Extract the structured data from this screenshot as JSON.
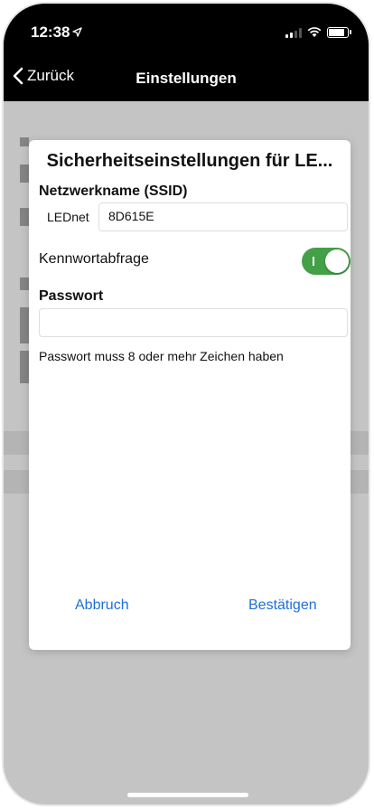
{
  "status_bar": {
    "time": "12:38",
    "location_icon": "location-arrow-icon",
    "signal_icon": "cellular-signal-icon",
    "wifi_icon": "wifi-icon",
    "battery_icon": "battery-icon"
  },
  "nav": {
    "back_label": "Zurück",
    "title": "Einstellungen"
  },
  "background_partial_letters": [
    "G",
    "I",
    "1",
    "(",
    "F",
    "L",
    "N",
    "L",
    "H",
    "N"
  ],
  "dialog": {
    "title": "Sicherheitseinstellungen für LE...",
    "ssid_label": "Netzwerkname (SSID)",
    "ssid_prefix": "LEDnet",
    "ssid_value": "8D615E",
    "password_prompt_label": "Kennwortabfrage",
    "password_prompt_on": true,
    "password_label": "Passwort",
    "password_value": "",
    "password_hint": "Passwort muss 8  oder mehr Zeichen haben",
    "cancel_label": "Abbruch",
    "confirm_label": "Bestätigen"
  },
  "colors": {
    "accent_blue": "#1e6fd9",
    "toggle_green": "#43a047",
    "overlay_gray": "#c4c4c4"
  }
}
